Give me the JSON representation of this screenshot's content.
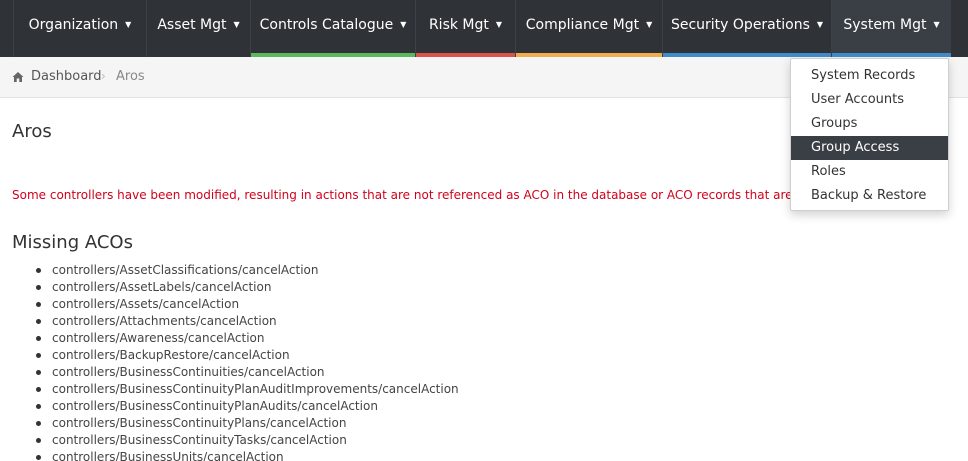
{
  "navbar": {
    "items": [
      {
        "label": "Organization",
        "accent": ""
      },
      {
        "label": "Asset Mgt",
        "accent": ""
      },
      {
        "label": "Controls Catalogue",
        "accent": "#5cb85c"
      },
      {
        "label": "Risk Mgt",
        "accent": "#d9534f"
      },
      {
        "label": "Compliance Mgt",
        "accent": "#f0ad4e"
      },
      {
        "label": "Security Operations",
        "accent": "#428bca"
      },
      {
        "label": "System Mgt",
        "accent": "#428bca"
      }
    ],
    "caret": "▼"
  },
  "breadcrumb": {
    "home": "Dashboard",
    "separator": "›",
    "current": "Aros"
  },
  "page": {
    "title": "Aros",
    "warning": "Some controllers have been modified, resulting in actions that are not referenced as ACO in the database or ACO records that are obsolete :",
    "section_title": "Missing ACOs",
    "missing_acos": [
      "controllers/AssetClassifications/cancelAction",
      "controllers/AssetLabels/cancelAction",
      "controllers/Assets/cancelAction",
      "controllers/Attachments/cancelAction",
      "controllers/Awareness/cancelAction",
      "controllers/BackupRestore/cancelAction",
      "controllers/BusinessContinuities/cancelAction",
      "controllers/BusinessContinuityPlanAuditImprovements/cancelAction",
      "controllers/BusinessContinuityPlanAudits/cancelAction",
      "controllers/BusinessContinuityPlans/cancelAction",
      "controllers/BusinessContinuityTasks/cancelAction",
      "controllers/BusinessUnits/cancelAction"
    ]
  },
  "dropdown": {
    "items": [
      "System Records",
      "User Accounts",
      "Groups",
      "Group Access",
      "Roles",
      "Backup & Restore"
    ],
    "selected": "Group Access"
  },
  "colors": {
    "navbar_bg": "#2f3338",
    "warning_text": "#d0021b",
    "dropdown_selected_bg": "#3a3f45"
  },
  "icons": {
    "breadcrumb_home": "home-icon"
  }
}
